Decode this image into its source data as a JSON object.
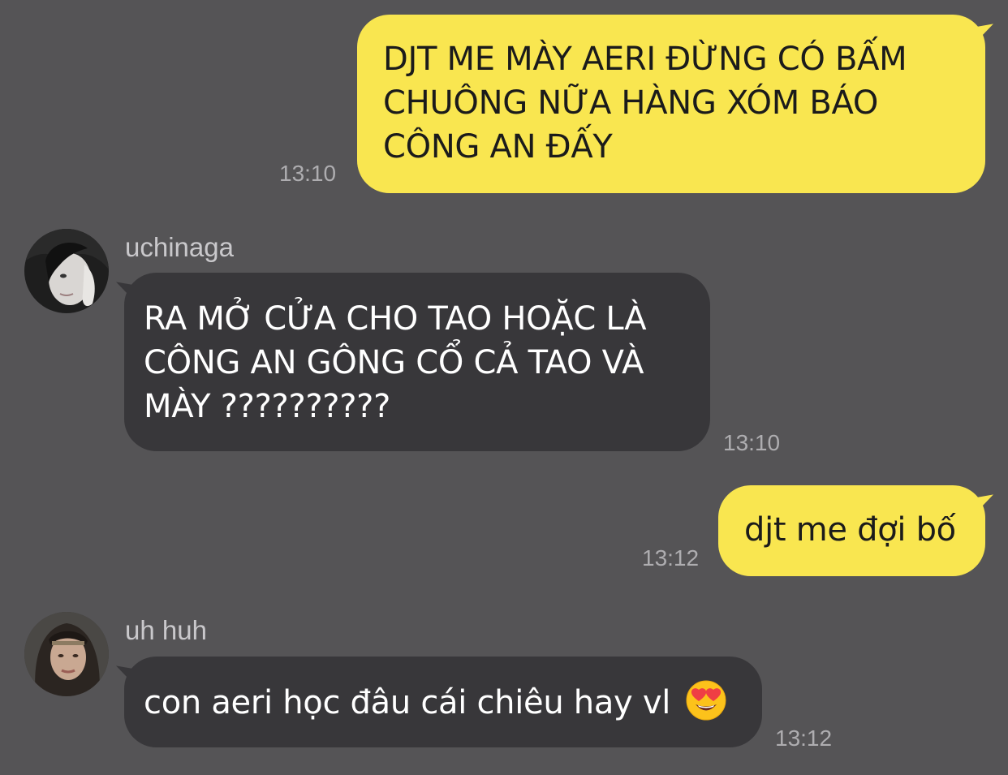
{
  "messages": [
    {
      "direction": "outgoing",
      "text": "DJT ME MÀY AERI ĐỪNG CÓ BẤM\nCHUÔNG NỮA HÀNG XÓM BÁO\nCÔNG AN ĐẤY",
      "time": "13:10"
    },
    {
      "direction": "incoming",
      "sender": "uchinaga",
      "avatar_icon": "profile-photo-avatar",
      "text": "RA MỞ CỬA CHO TAO HOẶC LÀ\nCÔNG AN GÔNG CỔ CẢ TAO VÀ\nMÀY ??????????",
      "time": "13:10"
    },
    {
      "direction": "outgoing",
      "text": "djt me đợi bố",
      "time": "13:12"
    },
    {
      "direction": "incoming",
      "sender": "uh huh",
      "avatar_icon": "profile-photo-avatar",
      "text": "con aeri học đâu cái chiêu hay vl",
      "emoji": "heart-eyes-emoji-icon",
      "time": "13:12"
    }
  ],
  "colors": {
    "background": "#555456",
    "outgoing_bubble": "#f9e650",
    "incoming_bubble": "#38373a",
    "timestamp": "#aeadb0"
  }
}
